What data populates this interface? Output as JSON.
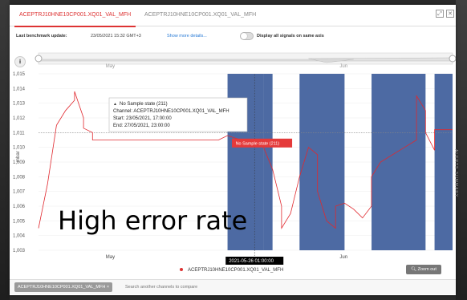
{
  "tabs": [
    {
      "label": "ACEPTRJ10HNE10CP001.XQ01_VAL_MFH"
    },
    {
      "label": "ACEPTRJ10HNE10CP001.XQ01_VAL_MFH"
    }
  ],
  "benchmark": {
    "label": "Last benchmark update:",
    "date": "23/05/2021 15:32 GMT+3",
    "link": "Show more details...",
    "toggle_label": "Display all signals on same axis"
  },
  "chart_data": {
    "type": "line",
    "title": "",
    "xlabel": "",
    "ylabel": "mbar",
    "yticks": [
      "1,015",
      "1,014",
      "1,013",
      "1,012",
      "1,011",
      "1,010",
      "1,009",
      "1,008",
      "1,007",
      "1,006",
      "1,005",
      "1,004",
      "1,003"
    ],
    "ylim": [
      1.003,
      1.015
    ],
    "xlim": [
      "2021-05-02",
      "2021-06-17"
    ],
    "xticks": [
      {
        "label": "May",
        "date": "2021-05-10"
      },
      {
        "label": "Jun",
        "date": "2021-06-05"
      }
    ],
    "navigator_labels": [
      "May",
      "Jun"
    ],
    "threshold": 1.011,
    "series": [
      {
        "name": "ACEPTRJ10HNE10CP001.XQ01_VAL_MFH",
        "color": "#e0282e",
        "points": [
          [
            "2021-05-02",
            1.0045
          ],
          [
            "2021-05-03",
            1.0075
          ],
          [
            "2021-05-04",
            1.0115
          ],
          [
            "2021-05-05",
            1.0125
          ],
          [
            "2021-05-06",
            1.0132
          ],
          [
            "2021-05-06",
            1.0138
          ],
          [
            "2021-05-07",
            1.012
          ],
          [
            "2021-05-07",
            1.0113
          ],
          [
            "2021-05-08",
            1.011
          ],
          [
            "2021-05-08",
            1.0105
          ],
          [
            "2021-05-22",
            1.0105
          ],
          [
            "2021-05-23",
            1.0108
          ],
          [
            "2021-05-27",
            1.01
          ],
          [
            "2021-05-28",
            1.0085
          ],
          [
            "2021-05-29",
            1.006
          ],
          [
            "2021-05-29",
            1.0045
          ],
          [
            "2021-05-30",
            1.0055
          ],
          [
            "2021-05-31",
            1.008
          ],
          [
            "2021-06-01",
            1.01
          ],
          [
            "2021-06-02",
            1.0095
          ],
          [
            "2021-06-02",
            1.007
          ],
          [
            "2021-06-03",
            1.005
          ],
          [
            "2021-06-04",
            1.0045
          ],
          [
            "2021-06-04",
            1.006
          ],
          [
            "2021-06-05",
            1.0062
          ],
          [
            "2021-06-06",
            1.0058
          ],
          [
            "2021-06-07",
            1.0052
          ],
          [
            "2021-06-08",
            1.006
          ],
          [
            "2021-06-08",
            1.008
          ],
          [
            "2021-06-09",
            1.009
          ],
          [
            "2021-06-13",
            1.0105
          ],
          [
            "2021-06-13",
            1.0135
          ],
          [
            "2021-06-14",
            1.0125
          ],
          [
            "2021-06-14",
            1.011
          ],
          [
            "2021-06-15",
            1.0098
          ],
          [
            "2021-06-15",
            1.0112
          ],
          [
            "2021-06-17",
            1.0112
          ]
        ]
      }
    ],
    "no_sample_bands": [
      [
        "2021-05-23",
        "2021-05-27"
      ],
      [
        "2021-05-27",
        "2021-05-28"
      ],
      [
        "2021-05-31",
        "2021-06-05"
      ],
      [
        "2021-06-08",
        "2021-06-14"
      ],
      [
        "2021-06-15",
        "2021-06-17"
      ]
    ],
    "band_color": "#4d6aa3",
    "band_label": "No Sample state (211)",
    "tooltip": {
      "title": "No Sample state (211)",
      "channel": "Channel: ACEPTRJ10HNE10CP001.XQ01_VAL_MFH",
      "start": "Start: 23/05/2021, 17:00:00",
      "end": "End: 27/05/2021, 23:00:00"
    },
    "crosshair_label": "2021-05-26 01:00:00",
    "crosshair_date": "2021-05-26"
  },
  "legend_label": "ACEPTRJ10HNE10CP001.XQ01_VAL_MFH",
  "zoom_out": "Zoom out",
  "side_tab": "ALERTS SUMMARY",
  "search": {
    "chip": "ACEPTRJ10HNE10CP001.XQ01_VAL_MFH",
    "placeholder": "Search another channels to compare"
  },
  "caption": "High error rate",
  "icons": {
    "download": "download-icon",
    "expand": "expand-icon",
    "close": "close-icon",
    "chip_close": "close-icon",
    "zoom": "zoom-out-icon",
    "warning": "warning-icon"
  }
}
